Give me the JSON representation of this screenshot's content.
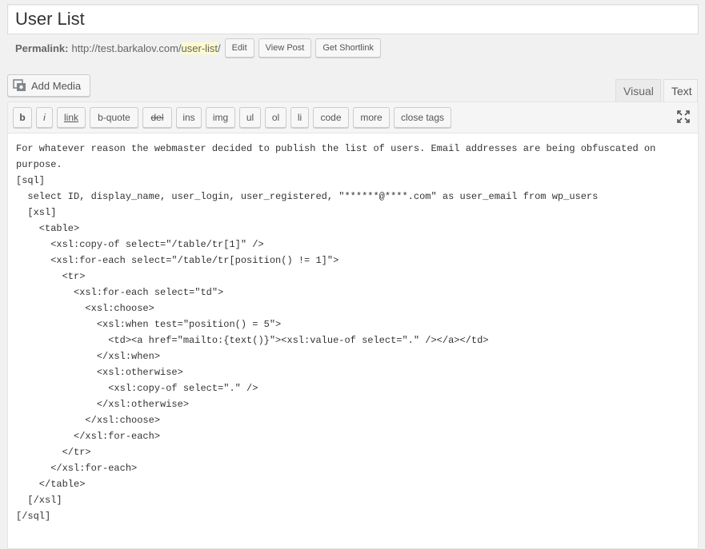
{
  "post": {
    "title": "User List"
  },
  "permalink": {
    "label": "Permalink:",
    "url_prefix": "http://test.barkalov.com/",
    "slug": "user-list",
    "url_suffix": "/",
    "edit_label": "Edit",
    "view_label": "View Post",
    "shortlink_label": "Get Shortlink"
  },
  "media": {
    "add_label": "Add Media",
    "icon": "media-icon"
  },
  "tabs": {
    "visual": "Visual",
    "text": "Text"
  },
  "quicktags": [
    "b",
    "i",
    "link",
    "b-quote",
    "del",
    "ins",
    "img",
    "ul",
    "ol",
    "li",
    "code",
    "more",
    "close tags"
  ],
  "toolbar": {
    "fullscreen_icon": "fullscreen-icon"
  },
  "content": [
    "For whatever reason the webmaster decided to publish the list of users. Email addresses are being obfuscated on",
    "purpose.",
    "[sql]",
    "  select ID, display_name, user_login, user_registered, \"******@****.com\" as user_email from wp_users",
    "  [xsl]",
    "    <table>",
    "      <xsl:copy-of select=\"/table/tr[1]\" />",
    "      <xsl:for-each select=\"/table/tr[position() != 1]\">",
    "        <tr>",
    "          <xsl:for-each select=\"td\">",
    "            <xsl:choose>",
    "              <xsl:when test=\"position() = 5\">",
    "                <td><a href=\"mailto:{text()}\"><xsl:value-of select=\".\" /></a></td>",
    "              </xsl:when>",
    "              <xsl:otherwise>",
    "                <xsl:copy-of select=\".\" />",
    "              </xsl:otherwise>",
    "            </xsl:choose>",
    "          </xsl:for-each>",
    "        </tr>",
    "      </xsl:for-each>",
    "    </table>",
    "  [/xsl]",
    "[/sql]"
  ]
}
